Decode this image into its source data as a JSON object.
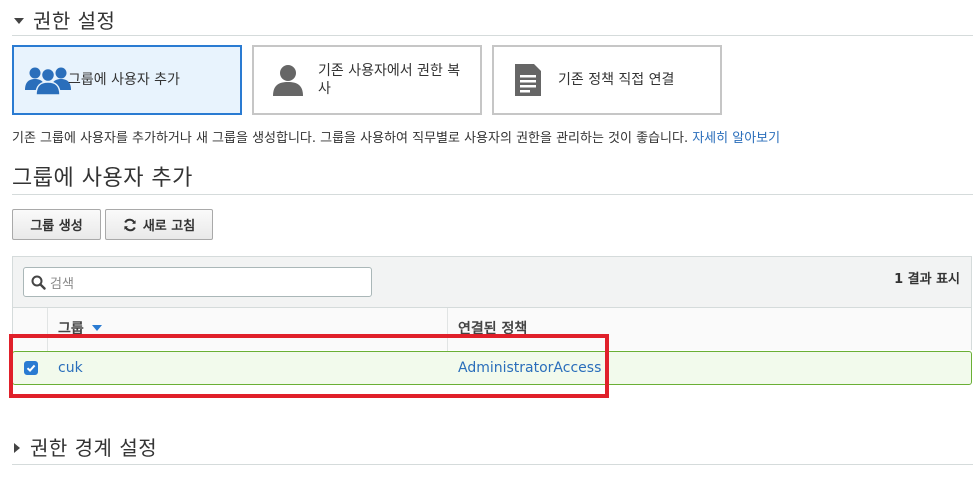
{
  "permissions_section": {
    "title": "권한 설정"
  },
  "options": [
    {
      "label": "그룹에 사용자 추가",
      "icon": "group-icon",
      "selected": true
    },
    {
      "label_line1": "기존 사용자에서 권한 복",
      "label_line2": "사",
      "icon": "user-icon",
      "selected": false
    },
    {
      "label": "기존 정책 직접 연결",
      "icon": "document-icon",
      "selected": false
    }
  ],
  "description": {
    "text": "기존 그룹에 사용자를 추가하거나 새 그룹을 생성합니다. 그룹을 사용하여 직무별로 사용자의 권한을 관리하는 것이 좋습니다. ",
    "link": "자세히 알아보기"
  },
  "group_section": {
    "title": "그룹에 사용자 추가",
    "create_button": "그룹 생성",
    "refresh_button": "새로 고침"
  },
  "table": {
    "search_placeholder": "검색",
    "result_count": "1 결과 표시",
    "columns": [
      "그룹",
      "연결된 정책"
    ],
    "rows": [
      {
        "checked": true,
        "group": "cuk",
        "policy": "AdministratorAccess"
      }
    ]
  },
  "boundary_section": {
    "title": "권한 경계 설정"
  },
  "colors": {
    "accent": "#2a7bd2",
    "link": "#2a6ebb",
    "highlight": "#e0202a",
    "selected_row_border": "#6aaf35"
  }
}
